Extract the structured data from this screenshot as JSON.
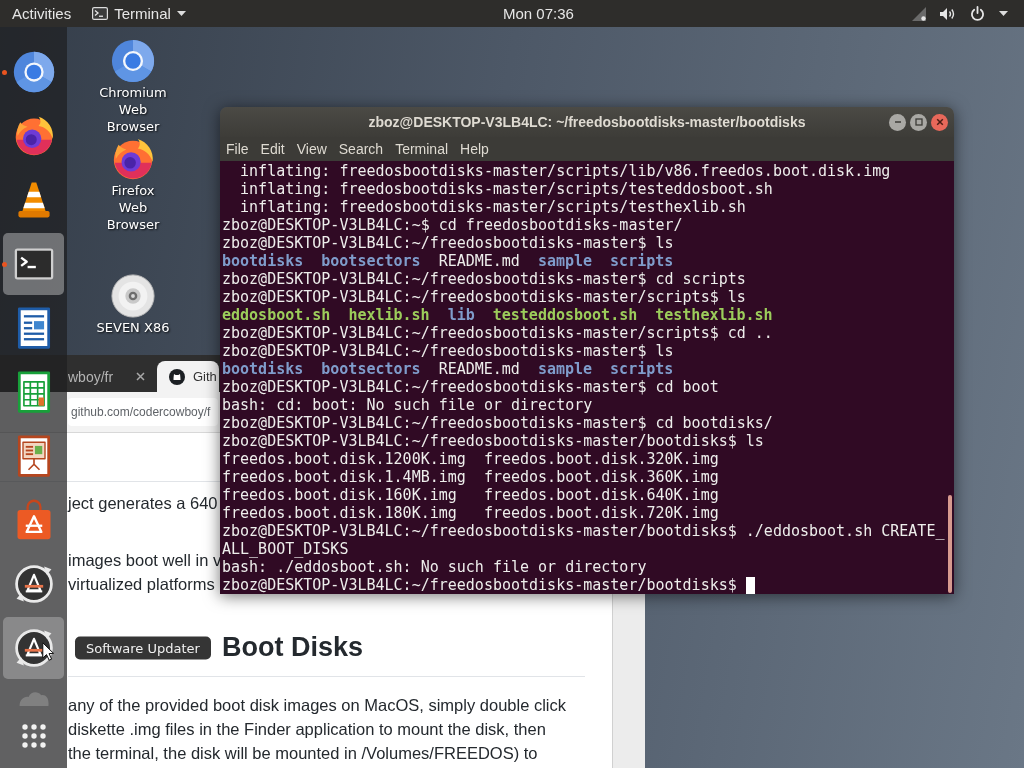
{
  "top_bar": {
    "activities": "Activities",
    "app_menu": "Terminal",
    "clock": "Mon 07:36"
  },
  "dock": {
    "tooltip": "Software Updater",
    "items": [
      {
        "kind": "chromium",
        "running": true,
        "selected": false,
        "hovered": false
      },
      {
        "kind": "firefox",
        "running": false,
        "selected": false,
        "hovered": false
      },
      {
        "kind": "vlc",
        "running": false,
        "selected": false,
        "hovered": false
      },
      {
        "kind": "terminal",
        "running": true,
        "selected": true,
        "hovered": false
      },
      {
        "kind": "writer",
        "running": false,
        "selected": false,
        "hovered": false
      },
      {
        "kind": "calc",
        "running": false,
        "selected": false,
        "hovered": false
      },
      {
        "kind": "impress",
        "running": false,
        "selected": false,
        "hovered": false
      },
      {
        "kind": "software",
        "running": false,
        "selected": false,
        "hovered": false
      },
      {
        "kind": "updater",
        "running": false,
        "selected": false,
        "hovered": false
      },
      {
        "kind": "updater",
        "running": false,
        "selected": false,
        "hovered": true
      },
      {
        "kind": "faded",
        "running": false,
        "selected": false,
        "hovered": false
      }
    ]
  },
  "desktop_icons": [
    {
      "kind": "chromium",
      "label": "Chromium Web Browser"
    },
    {
      "kind": "firefox",
      "label": "Firefox Web Browser"
    },
    {
      "kind": "disc",
      "label": "SEVEN X86"
    }
  ],
  "browser": {
    "tabs": [
      {
        "title": "wboy/fr",
        "selected": false
      },
      {
        "title": "Gith",
        "selected": true
      }
    ],
    "address": "github.com/codercowboy/f",
    "content": [
      {
        "kind": "paragraph",
        "lines": [
          "ject generates a 640"
        ]
      },
      {
        "kind": "paragraph",
        "lines": [
          "images boot well in v",
          "virtualized platforms"
        ]
      },
      {
        "kind": "heading",
        "text": "Boot Disks"
      },
      {
        "kind": "paragraph",
        "lines": [
          "any of the provided boot disk images on MacOS, simply double click",
          "diskette .img files in the Finder application to mount the disk, then",
          "the terminal, the disk will be mounted in /Volumes/FREEDOS) to"
        ]
      }
    ]
  },
  "terminal": {
    "title": "zboz@DESKTOP-V3LB4LC: ~/freedosbootdisks-master/bootdisks",
    "menu": [
      "File",
      "Edit",
      "View",
      "Search",
      "Terminal",
      "Help"
    ],
    "lines": [
      {
        "kind": "text",
        "text": "  inflating: freedosbootdisks-master/scripts/lib/v86.freedos.boot.disk.img",
        "cursor": false
      },
      {
        "kind": "text",
        "text": "  inflating: freedosbootdisks-master/scripts/testeddosboot.sh",
        "cursor": false
      },
      {
        "kind": "text",
        "text": "  inflating: freedosbootdisks-master/scripts/testhexlib.sh",
        "cursor": false
      },
      {
        "kind": "text",
        "text": "zboz@DESKTOP-V3LB4LC:~$ cd freedosbootdisks-master/",
        "cursor": false
      },
      {
        "kind": "text",
        "text": "zboz@DESKTOP-V3LB4LC:~/freedosbootdisks-master$ ls",
        "cursor": false
      },
      {
        "kind": "listing",
        "entries": [
          {
            "kind": "dir",
            "text": "bootdisks"
          },
          {
            "kind": "dir",
            "text": "bootsectors"
          },
          {
            "kind": "file",
            "text": "README.md"
          },
          {
            "kind": "dir",
            "text": "sample"
          },
          {
            "kind": "dir",
            "text": "scripts"
          }
        ],
        "cursor": false
      },
      {
        "kind": "text",
        "text": "zboz@DESKTOP-V3LB4LC:~/freedosbootdisks-master$ cd scripts",
        "cursor": false
      },
      {
        "kind": "text",
        "text": "zboz@DESKTOP-V3LB4LC:~/freedosbootdisks-master/scripts$ ls",
        "cursor": false
      },
      {
        "kind": "listing",
        "entries": [
          {
            "kind": "exec",
            "text": "eddosboot.sh"
          },
          {
            "kind": "exec",
            "text": "hexlib.sh"
          },
          {
            "kind": "dir",
            "text": "lib"
          },
          {
            "kind": "exec",
            "text": "testeddosboot.sh"
          },
          {
            "kind": "exec",
            "text": "testhexlib.sh"
          }
        ],
        "cursor": false
      },
      {
        "kind": "text",
        "text": "zboz@DESKTOP-V3LB4LC:~/freedosbootdisks-master/scripts$ cd ..",
        "cursor": false
      },
      {
        "kind": "text",
        "text": "zboz@DESKTOP-V3LB4LC:~/freedosbootdisks-master$ ls",
        "cursor": false
      },
      {
        "kind": "listing",
        "entries": [
          {
            "kind": "dir",
            "text": "bootdisks"
          },
          {
            "kind": "dir",
            "text": "bootsectors"
          },
          {
            "kind": "file",
            "text": "README.md"
          },
          {
            "kind": "dir",
            "text": "sample"
          },
          {
            "kind": "dir",
            "text": "scripts"
          }
        ],
        "cursor": false
      },
      {
        "kind": "text",
        "text": "zboz@DESKTOP-V3LB4LC:~/freedosbootdisks-master$ cd boot",
        "cursor": false
      },
      {
        "kind": "text",
        "text": "bash: cd: boot: No such file or directory",
        "cursor": false
      },
      {
        "kind": "text",
        "text": "zboz@DESKTOP-V3LB4LC:~/freedosbootdisks-master$ cd bootdisks/",
        "cursor": false
      },
      {
        "kind": "text",
        "text": "zboz@DESKTOP-V3LB4LC:~/freedosbootdisks-master/bootdisks$ ls",
        "cursor": false
      },
      {
        "kind": "text",
        "text": "freedos.boot.disk.1200K.img  freedos.boot.disk.320K.img",
        "cursor": false
      },
      {
        "kind": "text",
        "text": "freedos.boot.disk.1.4MB.img  freedos.boot.disk.360K.img",
        "cursor": false
      },
      {
        "kind": "text",
        "text": "freedos.boot.disk.160K.img   freedos.boot.disk.640K.img",
        "cursor": false
      },
      {
        "kind": "text",
        "text": "freedos.boot.disk.180K.img   freedos.boot.disk.720K.img",
        "cursor": false
      },
      {
        "kind": "text",
        "text": "zboz@DESKTOP-V3LB4LC:~/freedosbootdisks-master/bootdisks$ ./eddosboot.sh CREATE_",
        "cursor": false
      },
      {
        "kind": "text",
        "text": "ALL_BOOT_DISKS",
        "cursor": false
      },
      {
        "kind": "text",
        "text": "bash: ./eddosboot.sh: No such file or directory",
        "cursor": false
      },
      {
        "kind": "text",
        "text": "zboz@DESKTOP-V3LB4LC:~/freedosbootdisks-master/bootdisks$",
        "cursor": true
      }
    ]
  }
}
